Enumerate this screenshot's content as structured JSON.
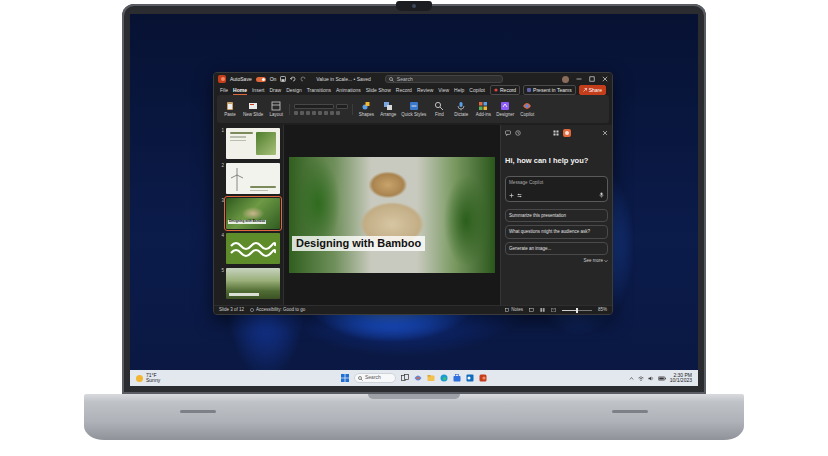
{
  "titlebar": {
    "autosave_label": "AutoSave",
    "autosave_on": true,
    "autosave_state": "On",
    "title": "Value in Scale... • Saved",
    "search": "Search"
  },
  "ribbon_tabs": [
    {
      "label": "File",
      "selected": false
    },
    {
      "label": "Home",
      "selected": true
    },
    {
      "label": "Insert",
      "selected": false
    },
    {
      "label": "Draw",
      "selected": false
    },
    {
      "label": "Design",
      "selected": false
    },
    {
      "label": "Transitions",
      "selected": false
    },
    {
      "label": "Animations",
      "selected": false
    },
    {
      "label": "Slide Show",
      "selected": false
    },
    {
      "label": "Record",
      "selected": false
    },
    {
      "label": "Review",
      "selected": false
    },
    {
      "label": "View",
      "selected": false
    },
    {
      "label": "Help",
      "selected": false
    },
    {
      "label": "Copilot",
      "selected": false
    }
  ],
  "ribbon_actions": [
    {
      "label": "Record",
      "kind": "record"
    },
    {
      "label": "Present in Teams",
      "kind": "teams"
    },
    {
      "label": "Share",
      "kind": "share"
    }
  ],
  "ribbon_buttons": [
    "Paste",
    "New Slide",
    "Layout",
    "Shapes",
    "Arrange",
    "Quick Styles",
    "Find",
    "Dictate",
    "Add-ins",
    "Designer",
    "Copilot"
  ],
  "slides": [
    {
      "number": "1",
      "kind": "light",
      "selected": false
    },
    {
      "number": "2",
      "kind": "turbine",
      "selected": false
    },
    {
      "number": "3",
      "kind": "photo",
      "selected": true,
      "title": "Designing with Bamboo"
    },
    {
      "number": "4",
      "kind": "pattern",
      "selected": false
    },
    {
      "number": "5",
      "kind": "landscape",
      "selected": false
    }
  ],
  "slide": {
    "title": "Designing with Bamboo"
  },
  "copilot": {
    "greeting": "Hi, how can I help you?",
    "placeholder": "Message Copilot",
    "suggestions": [
      "Summarize this presentation",
      "What questions might the audience ask?",
      "Generate an image..."
    ],
    "more": "See more"
  },
  "status_bar": {
    "slide": "Slide 3 of 12",
    "accessibility": "Accessibility: Good to go",
    "notes": "Notes",
    "zoom": "85%",
    "zoom_level": 0.5
  },
  "taskbar": {
    "temperature": "71°F",
    "weather": "Sunny",
    "search": "Search",
    "time": "2:30 PM",
    "date": "10/1/2023"
  }
}
